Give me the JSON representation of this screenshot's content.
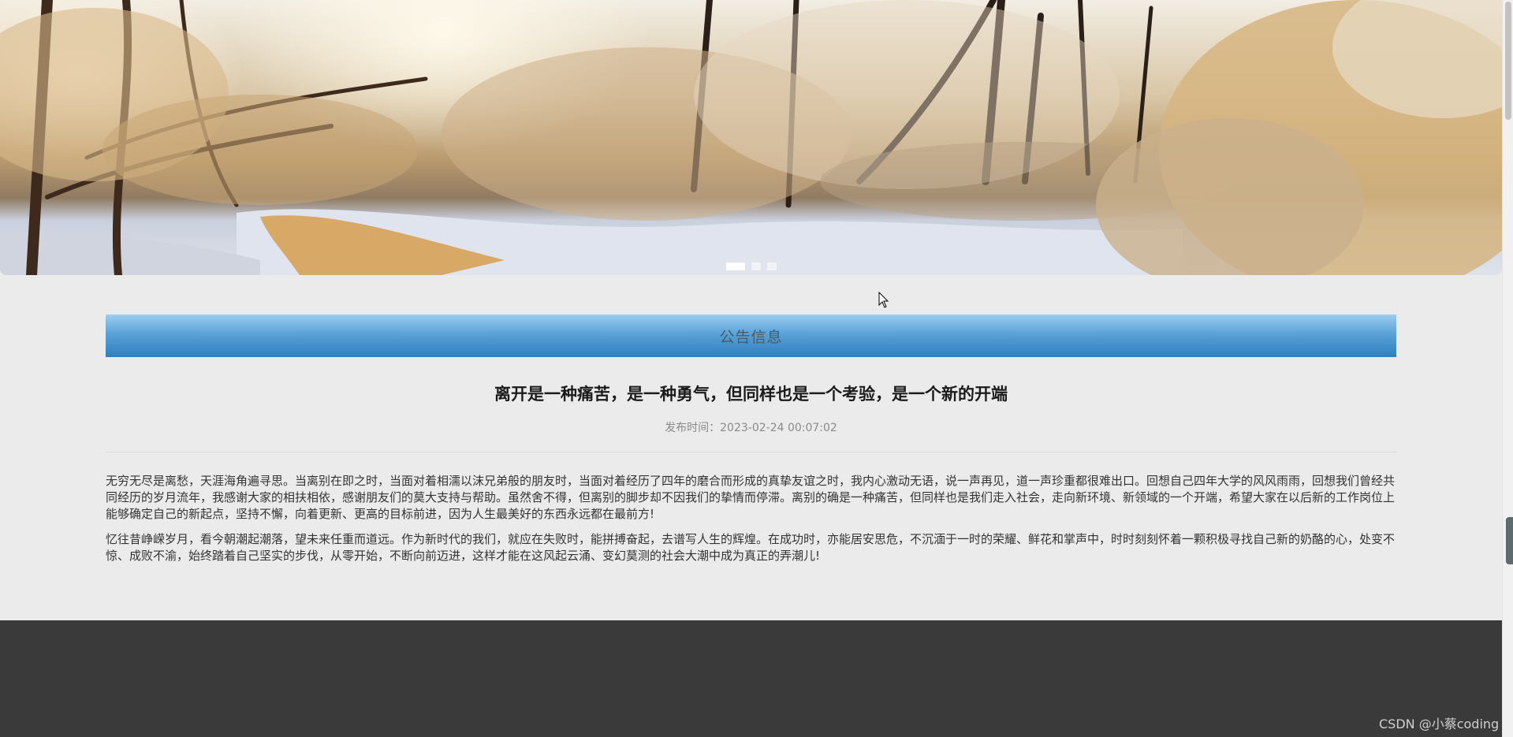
{
  "banner": {
    "slides": 3,
    "active_slide": 1
  },
  "notice": {
    "header": "公告信息",
    "title": "离开是一种痛苦，是一种勇气，但同样也是一个考验，是一个新的开端",
    "publish_label": "发布时间：",
    "publish_time": "2023-02-24 00:07:02",
    "paragraphs": [
      "无穷无尽是离愁，天涯海角遍寻思。当离别在即之时，当面对着相濡以沫兄弟般的朋友时，当面对着经历了四年的磨合而形成的真挚友谊之时，我内心激动无语，说一声再见，道一声珍重都很难出口。回想自己四年大学的风风雨雨，回想我们曾经共同经历的岁月流年，我感谢大家的相扶相依，感谢朋友们的莫大支持与帮助。虽然舍不得，但离别的脚步却不因我们的挚情而停滞。离别的确是一种痛苦，但同样也是我们走入社会，走向新环境、新领域的一个开端，希望大家在以后新的工作岗位上能够确定自己的新起点，坚持不懈，向着更新、更高的目标前进，因为人生最美好的东西永远都在最前方!",
      "忆往昔峥嵘岁月，看今朝潮起潮落，望未来任重而道远。作为新时代的我们，就应在失败时，能拼搏奋起，去谱写人生的辉煌。在成功时，亦能居安思危，不沉湎于一时的荣耀、鲜花和掌声中，时时刻刻怀着一颗积极寻找自己新的奶酪的心，处变不惊、成败不渝，始终踏着自己坚实的步伐，从零开始，不断向前迈进，这样才能在这风起云涌、变幻莫测的社会大潮中成为真正的弄潮儿!"
    ]
  },
  "watermark": "CSDN @小蔡coding",
  "colors": {
    "header_gradient_top": "#9ecdf0",
    "header_gradient_bottom": "#2f7fc0",
    "footer": "#3a3a3a",
    "page_bg": "#ebebeb"
  }
}
